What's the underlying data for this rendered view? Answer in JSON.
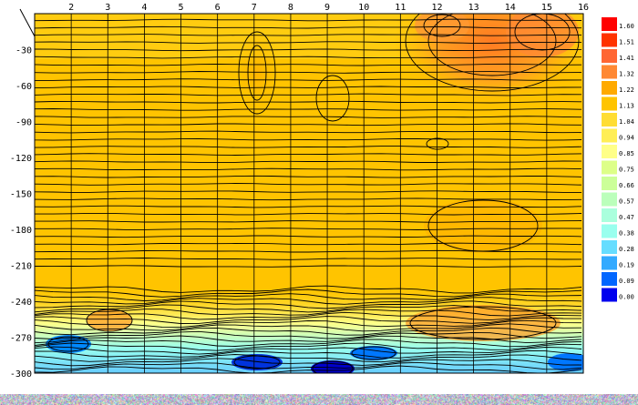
{
  "chart_data": {
    "type": "heatmap",
    "title": "",
    "xlabel": "",
    "ylabel": "",
    "x_ticks": [
      2,
      3,
      4,
      5,
      6,
      7,
      8,
      9,
      10,
      11,
      12,
      13,
      14,
      15,
      16
    ],
    "y_ticks": [
      -30,
      -60,
      -90,
      -120,
      -150,
      -180,
      -210,
      -240,
      -270,
      -300
    ],
    "xlim": [
      1,
      16
    ],
    "ylim": [
      -300,
      0
    ],
    "legend_placement": "right",
    "grid": true,
    "colorbar": {
      "levels": [
        "1.60",
        "1.51",
        "1.41",
        "1.32",
        "1.22",
        "1.13",
        "1.04",
        "0.94",
        "0.85",
        "0.75",
        "0.66",
        "0.57",
        "0.47",
        "0.38",
        "0.28",
        "0.19",
        "0.09",
        "0.00"
      ],
      "colors": [
        "#ff0000",
        "#ff3300",
        "#ff6633",
        "#ff8833",
        "#ffaa00",
        "#ffc400",
        "#ffdd33",
        "#ffee55",
        "#ffff88",
        "#ddff88",
        "#ccff99",
        "#bbffbb",
        "#aaffdd",
        "#99ffee",
        "#66ddff",
        "#33aaff",
        "#0066ff",
        "#0000ee"
      ]
    }
  }
}
